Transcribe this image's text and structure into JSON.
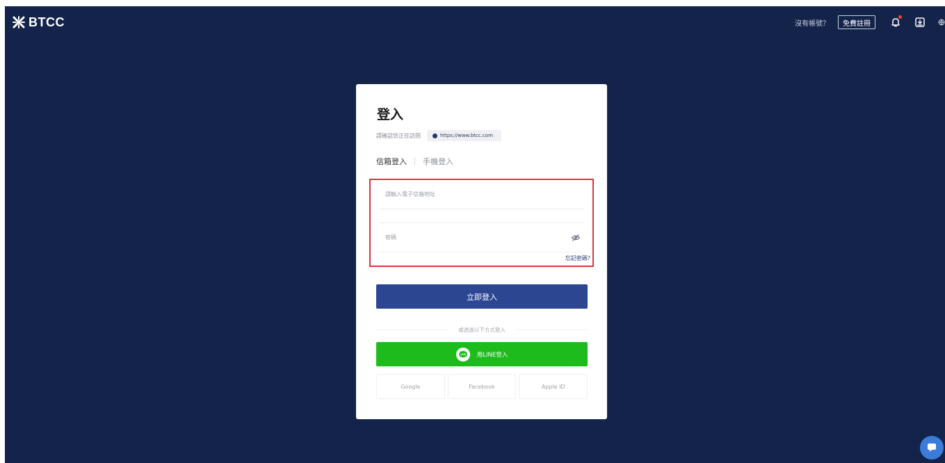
{
  "brand": {
    "name": "BTCC"
  },
  "header": {
    "no_account_text": "沒有帳號？",
    "signup_label": "免費註冊",
    "icons": [
      "bell-icon",
      "download-icon",
      "globe-icon"
    ]
  },
  "login": {
    "title": "登入",
    "verify_text": "請確認您正在訪問",
    "url": "https://www.btcc.com",
    "tabs": [
      {
        "label": "信箱登入",
        "active": true
      },
      {
        "label": "手機登入",
        "active": false
      }
    ],
    "email_placeholder": "請輸入電子信箱地址",
    "password_placeholder": "密碼",
    "forgot_label": "忘記密碼?",
    "submit_label": "立即登入",
    "divider_text": "或透過以下方式登入",
    "line_label": "用LINE登入",
    "line_logo_text": "LINE",
    "social": [
      {
        "label": "Google"
      },
      {
        "label": "Facebook"
      },
      {
        "label": "Apple ID"
      }
    ]
  },
  "colors": {
    "background": "#13234a",
    "primary_button": "#2c4691",
    "line_green": "#1ebb1d",
    "highlight_border": "#d9343c",
    "chat_fab": "#3d7bd9"
  }
}
